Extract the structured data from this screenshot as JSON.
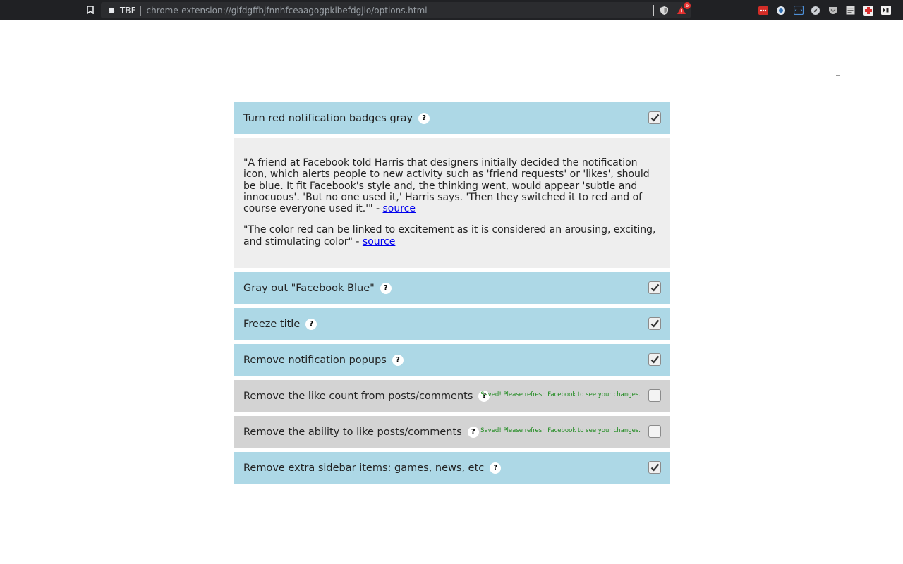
{
  "browser": {
    "extension_tag": "TBF",
    "url": "chrome-extension://gifdgffbjfnnhfceaagogpkibefdgjio/options.html",
    "alert_badge_count": "6",
    "toolbar_icons": [
      "lastpass-icon",
      "circle-icon",
      "devtools-icon",
      "compass-icon",
      "pocket-icon",
      "page-icon",
      "medical-cross-icon",
      "media-icon"
    ]
  },
  "colors": {
    "enabled_row": "#add8e6",
    "disabled_row": "#d3d3d3",
    "info_box": "#eeeeee",
    "saved_text": "#1e8a1e",
    "link": "#0000ee"
  },
  "options": [
    {
      "label": "Turn red notification badges gray",
      "help": "?",
      "checked": true,
      "saved": ""
    },
    {
      "label": "Gray out \"Facebook Blue\"",
      "help": "?",
      "checked": true,
      "saved": ""
    },
    {
      "label": "Freeze title",
      "help": "?",
      "checked": true,
      "saved": ""
    },
    {
      "label": "Remove notification popups",
      "help": "?",
      "checked": true,
      "saved": ""
    },
    {
      "label": "Remove the like count from posts/comments",
      "help": "?",
      "checked": false,
      "saved": "Saved! Please refresh Facebook to see your changes."
    },
    {
      "label": "Remove the ability to like posts/comments",
      "help": "?",
      "checked": false,
      "saved": "Saved! Please refresh Facebook to see your changes."
    },
    {
      "label": "Remove extra sidebar items: games, news, etc",
      "help": "?",
      "checked": true,
      "saved": ""
    }
  ],
  "info": {
    "quote1": "\"A friend at Facebook told Harris that designers initially decided the notification icon, which alerts people to new activity such as 'friend requests' or 'likes', should be blue. It fit Facebook's style and, the thinking went, would appear 'subtle and innocuous'. 'But no one used it,' Harris says. 'Then they switched it to red and of course everyone used it.'\" - ",
    "quote1_link": "source",
    "quote2": "\"The color red can be linked to excitement as it is considered an arousing, exciting, and stimulating color\" - ",
    "quote2_link": "source"
  }
}
